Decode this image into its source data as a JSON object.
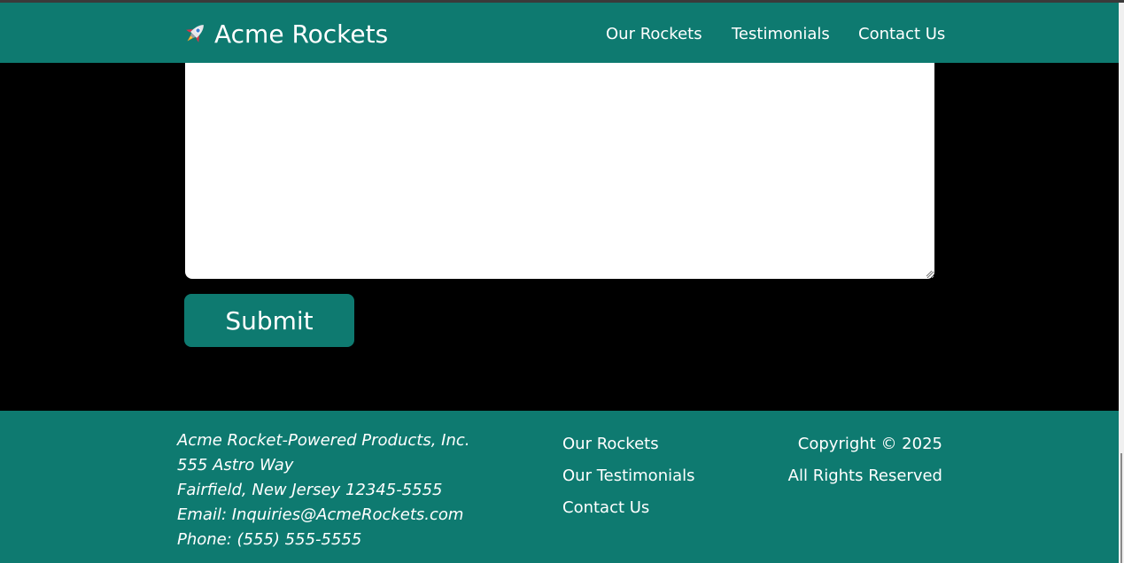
{
  "header": {
    "brand": "Acme Rockets",
    "brand_icon": "rocket-icon",
    "nav": [
      {
        "label": "Our Rockets"
      },
      {
        "label": "Testimonials"
      },
      {
        "label": "Contact Us"
      }
    ]
  },
  "form": {
    "message_value": "",
    "submit_label": "Submit"
  },
  "footer": {
    "address": {
      "company": "Acme Rocket-Powered Products, Inc.",
      "street": "555 Astro Way",
      "city": "Fairfield, New Jersey 12345-5555",
      "email": "Email: Inquiries@AcmeRockets.com",
      "phone": "Phone: (555) 555-5555"
    },
    "links": [
      {
        "label": "Our Rockets"
      },
      {
        "label": "Our Testimonials"
      },
      {
        "label": "Contact Us"
      }
    ],
    "copyright": "Copyright © 2025",
    "rights": "All Rights Reserved"
  },
  "colors": {
    "teal": "#0e7a70",
    "background": "#000000",
    "text": "#ffffff"
  }
}
